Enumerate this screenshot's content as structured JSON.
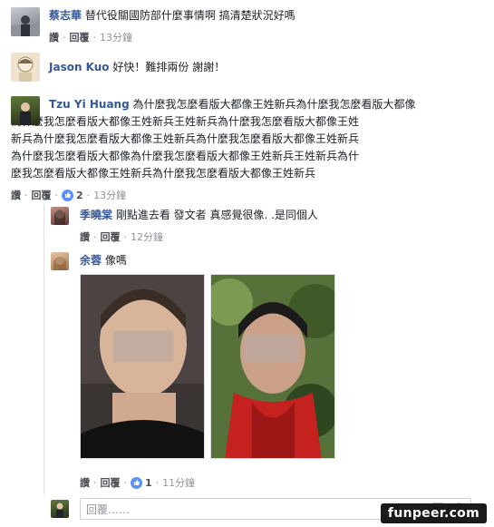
{
  "comments": [
    {
      "author": "蔡志華",
      "text": "替代役關國防部什麼事情啊 搞清楚狀況好嗎",
      "actions": {
        "like": "讚",
        "reply": "回覆",
        "time": "13分鐘"
      }
    },
    {
      "author": "Jason Kuo",
      "text": "好快！難排兩份 謝謝！"
    },
    {
      "author": "Tzu Yi Huang",
      "text_lines": [
        "為什麼我怎麼看版大都像王姓新兵為什麼我怎麼看版大都像",
        "為什麼我怎麼看版大都像王姓新兵王姓新兵為什麼我怎麼看版大都像王姓",
        "新兵為什麼我怎麼看版大都像王姓新兵為什麼我怎麼看版大都像王姓新兵",
        "為什麼我怎麼看版大都像為什麼我怎麼看版大都像王姓新兵王姓新兵為什",
        "麼我怎麼看版大都像王姓新兵為什麼我怎麼看版大都像王姓新兵"
      ],
      "actions": {
        "like": "讚",
        "reply": "回覆",
        "likes": "2",
        "time": "13分鐘"
      }
    }
  ],
  "replies": [
    {
      "author": "季曉棠",
      "text": "剛點進去看 發文者 真感覺很像. .是同個人",
      "actions": {
        "like": "讚",
        "reply": "回覆",
        "time": "12分鐘"
      }
    },
    {
      "author": "余蓉",
      "text": "像嗎",
      "actions": {
        "like": "讚",
        "reply": "回覆",
        "likes": "1",
        "time": "11分鐘"
      }
    }
  ],
  "reply_box": {
    "placeholder": "回覆……"
  },
  "watermark": "funpeer.com",
  "colors": {
    "name": "#365899",
    "meta": "#90949c",
    "like": "#5890ff"
  }
}
